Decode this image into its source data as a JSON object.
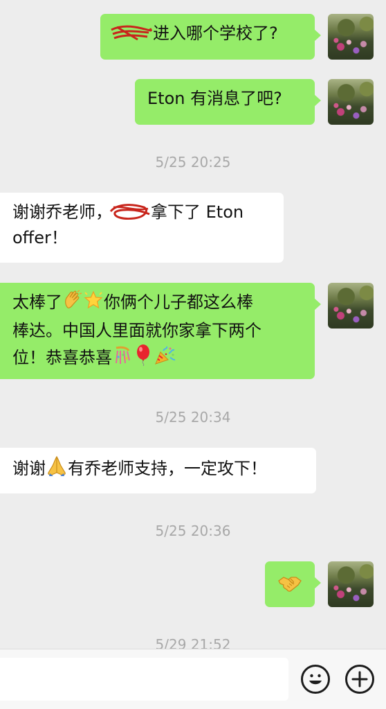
{
  "messages": [
    {
      "side": "out",
      "pre": "",
      "post": "进入哪个学校了?"
    },
    {
      "side": "out",
      "text": "Eton 有消息了吧?"
    },
    {
      "side": "in",
      "pre": "谢谢乔老师，",
      "post": "拿下了 Eton",
      "line2": "offer！"
    },
    {
      "side": "out",
      "line1a": "太棒了",
      "line1b": "你俩个儿子都这么棒",
      "line2": "棒达。中国人里面就你家拿下两个",
      "line3": "位！恭喜恭喜"
    },
    {
      "side": "in",
      "a": "谢谢",
      "b": "有乔老师支持，一定攻下！"
    },
    {
      "side": "out",
      "icon": "handshake-emoji"
    }
  ],
  "timestamps": [
    "5/25 20:25",
    "5/25 20:34",
    "5/25 20:36",
    "5/29 21:52"
  ],
  "input": {
    "placeholder": ""
  },
  "buttons": {
    "emoji": "emoji-button",
    "plus": "plus-button"
  },
  "colors": {
    "outgoing_bubble": "#95ec69",
    "incoming_bubble": "#ffffff",
    "background": "#ededed",
    "scribble": "#c8251c"
  }
}
